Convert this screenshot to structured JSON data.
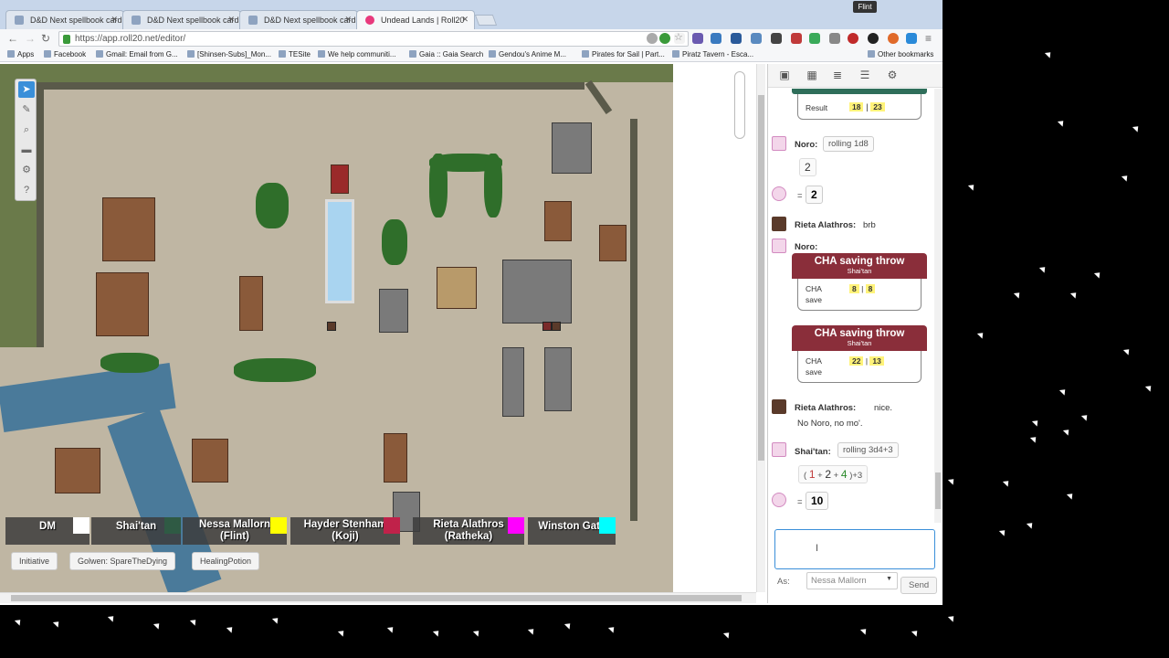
{
  "browser": {
    "tabs": [
      {
        "title": "D&D Next spellbook card"
      },
      {
        "title": "D&D Next spellbook card"
      },
      {
        "title": "D&D Next spellbook card"
      },
      {
        "title": "Undead Lands | Roll20"
      }
    ],
    "profile": "Flint",
    "url": "https://app.roll20.net/editor/",
    "bookmarks": [
      "Apps",
      "Facebook",
      "Gmail: Email from G...",
      "[Shinsen-Subs]_Mon...",
      "TESite",
      "We help communiti...",
      "Gaia :: Gaia Search",
      "Gendou's Anime M...",
      "Pirates for Sail | Part...",
      "Piratz Tavern - Esca...",
      "Other bookmarks"
    ]
  },
  "players": [
    {
      "name": "DM",
      "color": "#ffffff"
    },
    {
      "name": "Shai'tan",
      "color": "#2f5a44"
    },
    {
      "name": "Nessa Mallorn\n(Flint)",
      "color": "#ffff00"
    },
    {
      "name": "Hayder Stenham\n(Koji)",
      "color": "#c0224a"
    },
    {
      "name": "Rieta Alathros\n(Ratheka)",
      "color": "#ff00ff"
    },
    {
      "name": "Winston Gatz",
      "color": "#00ffff"
    }
  ],
  "macros": [
    "Initiative",
    "Golwen: SpareTheDying",
    "HealingPotion"
  ],
  "chat": {
    "top_result": {
      "label": "Result",
      "a": "18",
      "b": "23"
    },
    "noro_roll": {
      "who": "Noro:",
      "cmd": "rolling 1d8",
      "die": "2",
      "eq": "=",
      "total": "2"
    },
    "rieta1": {
      "who": "Rieta Alathros:",
      "text": "brb"
    },
    "noro2": {
      "who": "Noro:"
    },
    "save1": {
      "title": "CHA saving throw",
      "sub": "Shai'tan",
      "l1": "CHA",
      "l2": "save",
      "a": "8",
      "b": "8"
    },
    "save2": {
      "title": "CHA saving throw",
      "sub": "Shai'tan",
      "l1": "CHA",
      "l2": "save",
      "a": "22",
      "b": "13"
    },
    "rieta2": {
      "who": "Rieta Alathros:",
      "text": "nice.",
      "text2": "No Noro, no mo'."
    },
    "shai": {
      "who": "Shai'tan:",
      "cmd": "rolling 3d4+3",
      "d1": "1",
      "d2": "2",
      "d3": "4",
      "plus": "+",
      "mod": ")+3",
      "open": "(",
      "eq": "=",
      "total": "10"
    },
    "as_label": "As:",
    "as_value": "Nessa Mallorn",
    "send": "Send"
  },
  "colors": {
    "accent": "#3a8fd9",
    "template_header": "#8a2e3a",
    "highlight": "#fff37a"
  }
}
